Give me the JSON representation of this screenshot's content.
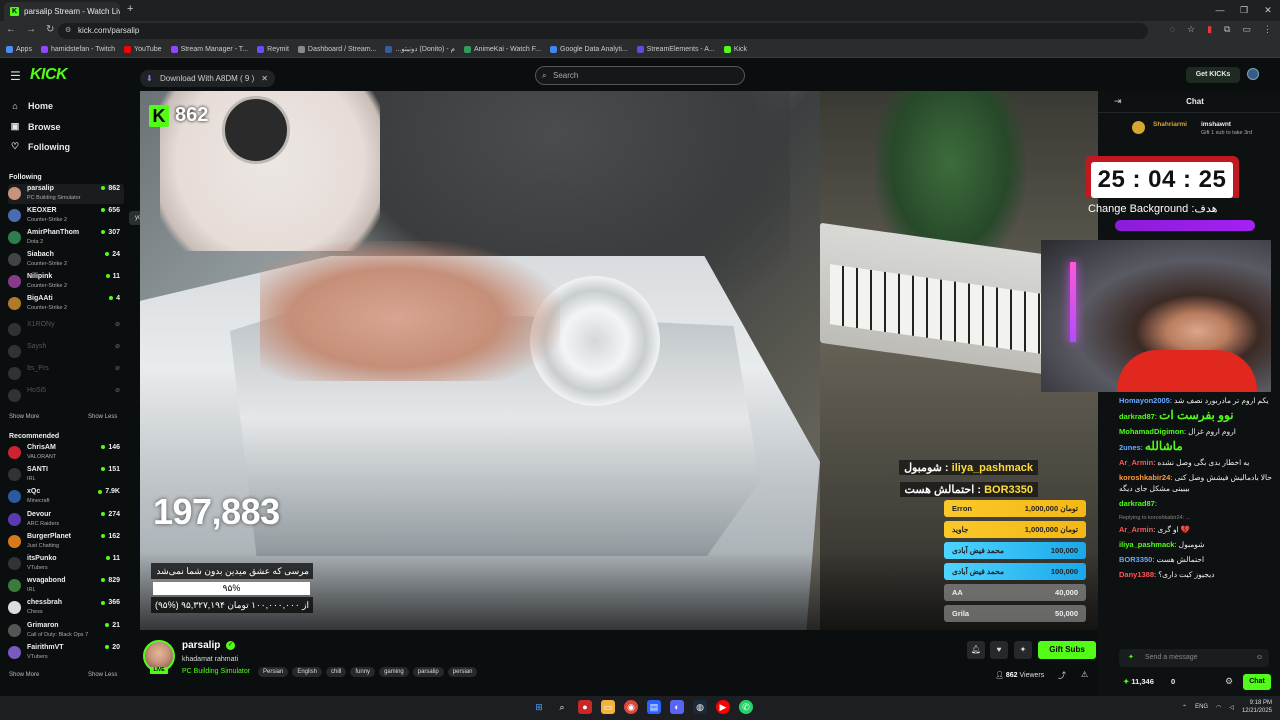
{
  "browser": {
    "tab_title": "parsalip Stream - Watch Live o",
    "tab_favicon": "K",
    "url": "kick.com/parsalip",
    "bookmarks": [
      "Apps",
      "hamidstefan - Twitch",
      "YouTube",
      "Stream Manager - T...",
      "Reymit",
      "Dashboard / Stream...",
      "...دونیتو (Donito) - م",
      "AnimeKai - Watch F...",
      "Google Data Analyti...",
      "StreamElements - A...",
      "Kick"
    ]
  },
  "header": {
    "logo": "KICK",
    "download_pill": "Download With A8DM ( 9 )",
    "search_placeholder": "Search",
    "get_kicks": "Get KICKs"
  },
  "sidebar": {
    "nav": [
      {
        "label": "Home",
        "icon": "home-icon"
      },
      {
        "label": "Browse",
        "icon": "browse-icon"
      },
      {
        "label": "Following",
        "icon": "heart-icon"
      }
    ],
    "following_title": "Following",
    "following": [
      {
        "name": "parsalip",
        "game": "PC Building Simulator",
        "viewers": "862",
        "color": "#c7937a"
      },
      {
        "name": "KEOXER",
        "game": "Counter-Strike 2",
        "viewers": "656",
        "color": "#4b6bb0"
      },
      {
        "name": "AmirPhanThom",
        "game": "Dota 2",
        "viewers": "307",
        "color": "#2e7d4f"
      },
      {
        "name": "Siabach",
        "game": "Counter-Strike 2",
        "viewers": "24",
        "color": "#444"
      },
      {
        "name": "Nilipink",
        "game": "Counter-Strike 2",
        "viewers": "11",
        "color": "#8a3a8a"
      },
      {
        "name": "BigAAti",
        "game": "Counter-Strike 2",
        "viewers": "4",
        "color": "#b07a2a"
      }
    ],
    "offline": [
      {
        "name": "X1RONy",
        "color": "#777"
      },
      {
        "name": "Saysh",
        "color": "#777"
      },
      {
        "name": "Its_Prs",
        "color": "#777"
      },
      {
        "name": "HoSi5",
        "color": "#777"
      }
    ],
    "show_more": "Show More",
    "show_less": "Show Less",
    "recommended_title": "Recommended",
    "recommended": [
      {
        "name": "ChrisAM",
        "game": "VALORANT",
        "viewers": "146",
        "color": "#c23"
      },
      {
        "name": "SANTI",
        "game": "IRL",
        "viewers": "151",
        "color": "#333"
      },
      {
        "name": "xQc",
        "game": "Minecraft",
        "viewers": "7.9K",
        "color": "#2a5aa0"
      },
      {
        "name": "Devour",
        "game": "ARC Raiders",
        "viewers": "274",
        "color": "#5a3ab0"
      },
      {
        "name": "BurgerPlanet",
        "game": "Just Chatting",
        "viewers": "162",
        "color": "#d97a1a"
      },
      {
        "name": "itsPunko",
        "game": "VTubers",
        "viewers": "11",
        "color": "#333"
      },
      {
        "name": "wvagabond",
        "game": "IRL",
        "viewers": "829",
        "color": "#3a7a3a"
      },
      {
        "name": "chessbrah",
        "game": "Chess",
        "viewers": "366",
        "color": "#ddd"
      },
      {
        "name": "Grimaron",
        "game": "Call of Duty: Black Ops 7",
        "viewers": "21",
        "color": "#555"
      },
      {
        "name": "FairithmVT",
        "game": "VTubers",
        "viewers": "20",
        "color": "#7a5ac0"
      }
    ],
    "tooltip": "yooo"
  },
  "video": {
    "viewer_count": "862",
    "goal_count": "197,883",
    "goal_title": "مرسی که عشق میدین بدون شما نمی‌شد",
    "goal_percent": "۹۵%",
    "goal_fill": 0.95,
    "goal_amount": "(۹۵%) ۹۵,۳۲۷,۱۹۴ از ۱۰۰,۰۰۰,۰۰۰ تومان",
    "donor_feed": [
      {
        "user": "iliya_pashmack",
        "text": "شومبول :"
      },
      {
        "user": "BOR3350",
        "text": "احتمالش هست :"
      }
    ],
    "leaderboard": [
      {
        "name": "Erron",
        "amount": "1,000,000 تومان",
        "style": "gold"
      },
      {
        "name": "جاوید",
        "amount": "1,000,000 تومان",
        "style": "gold"
      },
      {
        "name": "محمد فیض آبادی",
        "amount": "100,000",
        "style": "cyan"
      },
      {
        "name": "محمد فیض آبادی",
        "amount": "100,000",
        "style": "cyan"
      },
      {
        "name": "AA",
        "amount": "40,000",
        "style": "grey"
      },
      {
        "name": "Grila",
        "amount": "50,000",
        "style": "grey"
      }
    ]
  },
  "stream_info": {
    "name": "parsalip",
    "title": "khadamat rahmati",
    "category": "PC Building Simulator",
    "tags": [
      "Persian",
      "English",
      "chill",
      "funny",
      "gaming",
      "parsalip",
      "persian"
    ],
    "gift_subs": "Gift Subs",
    "viewers": "862",
    "viewers_label": "Viewers",
    "live": "LIVE"
  },
  "chat": {
    "title": "Chat",
    "pinned": {
      "user1": "Shahriarmi",
      "user1_sub": "2",
      "user2": "imshawnt",
      "text": "Gift 1 sub to take 3rd",
      "count": "1"
    },
    "timer": "25 : 04 : 25",
    "change_bg": "Change Background :هدف",
    "messages": [
      {
        "user": "Homayon2005",
        "color": "#6aa9ff",
        "text": "یکم اروم تر مادربورد نصف شد"
      },
      {
        "user": "darkrad87",
        "color": "#53fc18",
        "text": "نوو بفرست ات",
        "big": true,
        "textcolor": "#53fc18"
      },
      {
        "user": "MohamadDigimon",
        "color": "#53fc18",
        "text": "اروم اروم غزال"
      },
      {
        "user": "2unes",
        "color": "#6aa9ff",
        "text": "ماشالله",
        "big": true,
        "textcolor": "#53fc18"
      },
      {
        "user": "Ar_Armin",
        "color": "#ff5656",
        "text": "یه اخطار بدی بگی وصل نشده",
        "reply": ""
      },
      {
        "user": "koroshkabir24",
        "color": "#ff9b3d",
        "text": "حالا بادمالیش فیشش وصل کنی بیبینی مشکل جای دیگه"
      },
      {
        "user": "darkrad87",
        "color": "#53fc18",
        "text": ""
      },
      {
        "user": "Ar_Armin",
        "color": "#ff5656",
        "text": "او گری 💔",
        "reply": "Replying to koroshkabir24: ..."
      },
      {
        "user": "iliya_pashmack",
        "color": "#53fc18",
        "text": "شومبول"
      },
      {
        "user": "BOR3350",
        "color": "#6aa9ff",
        "text": "احتمالش هست"
      },
      {
        "user": "Dany1388",
        "color": "#ff5656",
        "text": "دیجیوز کیت داری؟"
      }
    ],
    "input_placeholder": "Send a message",
    "points": "11,346",
    "zero": "0",
    "chat_button": "Chat"
  },
  "taskbar": {
    "lang": "ENG",
    "time": "9:18 PM",
    "date": "12/21/2025"
  },
  "colors": {
    "kick_green": "#53fc18",
    "timer_red": "#c01721"
  }
}
